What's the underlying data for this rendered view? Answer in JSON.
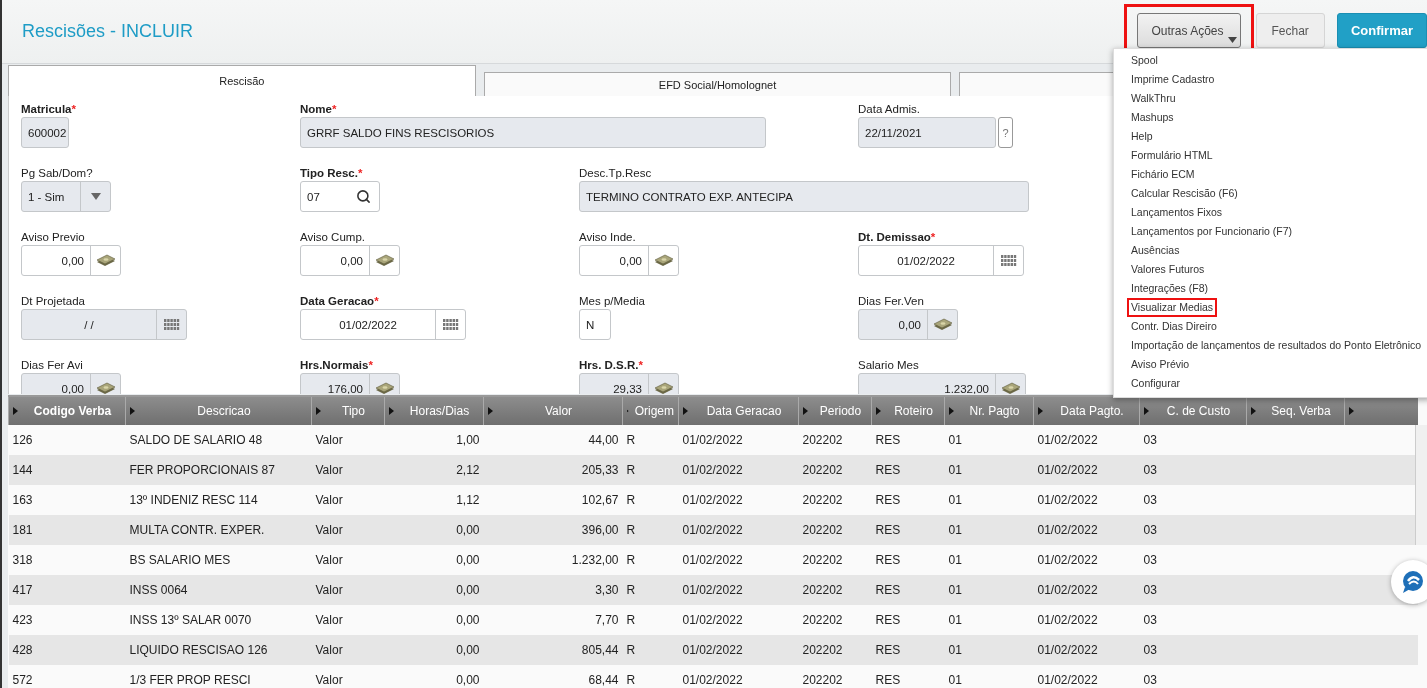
{
  "header": {
    "title": "Rescisões - INCLUIR",
    "buttons": [
      {
        "label": "Outras Ações",
        "kind": "dropdown",
        "highlighted": true
      },
      {
        "label": "Fechar",
        "kind": "secondary",
        "highlighted": false
      },
      {
        "label": "Confirmar",
        "kind": "primary",
        "highlighted": false
      }
    ]
  },
  "tabs": [
    {
      "label": "Rescisão",
      "selected": true
    },
    {
      "label": "EFD Social/Homolognet",
      "selected": false
    },
    {
      "selected": false
    }
  ],
  "form": {
    "rows": [
      [
        {
          "label": "Matricula",
          "required": true,
          "required_mark": "*",
          "value": "600002",
          "kind": "text",
          "readonly": true
        },
        {
          "label": "Nome",
          "required": true,
          "required_mark": "*",
          "value": "GRRF SALDO FINS RESCISORIOS",
          "kind": "text",
          "readonly": true
        },
        null,
        {
          "label": "Data Admis.",
          "required": false,
          "value": "22/11/2021",
          "kind": "help",
          "readonly": true,
          "help": "?"
        }
      ],
      [
        {
          "label": "Pg Sab/Dom?",
          "required": false,
          "value": "1 - Sim",
          "kind": "select",
          "readonly": true
        },
        {
          "label": "Tipo Resc.",
          "required": true,
          "required_mark": "*",
          "value": "07",
          "kind": "search",
          "readonly": false
        },
        {
          "label": "Desc.Tp.Resc",
          "required": false,
          "value": "TERMINO CONTRATO EXP. ANTECIPA",
          "kind": "text",
          "readonly": true
        },
        null
      ],
      [
        {
          "label": "Aviso Previo",
          "required": false,
          "value": "0,00",
          "kind": "money",
          "readonly": false
        },
        {
          "label": "Aviso Cump.",
          "required": false,
          "value": "0,00",
          "kind": "money",
          "readonly": false
        },
        {
          "label": "Aviso Inde.",
          "required": false,
          "value": "0,00",
          "kind": "money",
          "readonly": false
        },
        {
          "label": "Dt. Demissao",
          "required": true,
          "required_mark": "*",
          "value": "01/02/2022",
          "kind": "date",
          "readonly": false
        }
      ],
      [
        {
          "label": "Dt Projetada",
          "required": false,
          "value": "/ /",
          "kind": "date",
          "readonly": true
        },
        {
          "label": "Data Geracao",
          "required": true,
          "required_mark": "*",
          "value": "01/02/2022",
          "kind": "date",
          "readonly": false
        },
        {
          "label": "Mes p/Media",
          "required": false,
          "value": "N",
          "kind": "text",
          "readonly": false
        },
        {
          "label": "Dias Fer.Ven",
          "required": false,
          "value": "0,00",
          "kind": "money",
          "readonly": true
        }
      ],
      [
        {
          "label": "Dias Fer Avi",
          "required": false,
          "value": "0,00",
          "kind": "money",
          "readonly": true
        },
        {
          "label": "Hrs.Normais",
          "required": true,
          "required_mark": "*",
          "value": "176,00",
          "kind": "money",
          "readonly": true
        },
        {
          "label": "Hrs. D.S.R.",
          "required": true,
          "required_mark": "*",
          "value": "29,33",
          "kind": "money",
          "readonly": true
        },
        {
          "label": "Salario Mes",
          "required": false,
          "value": "1.232,00",
          "kind": "money",
          "readonly": true
        }
      ]
    ]
  },
  "table": {
    "columns": [
      "Codigo Verba",
      "Descricao",
      "Tipo",
      "Horas/Dias",
      "Valor",
      "Origem",
      "Data Geracao",
      "Periodo",
      "Roteiro",
      "Nr. Pagto",
      "Data Pagto.",
      "C. de Custo",
      "Seq. Verba",
      null
    ],
    "rows": [
      [
        "126",
        "SALDO DE SALARIO 48",
        "Valor",
        "1,00",
        "44,00",
        "R",
        "01/02/2022",
        "202202",
        "RES",
        "01",
        "01/02/2022",
        "03"
      ],
      [
        "144",
        "FER PROPORCIONAIS 87",
        "Valor",
        "2,12",
        "205,33",
        "R",
        "01/02/2022",
        "202202",
        "RES",
        "01",
        "01/02/2022",
        "03"
      ],
      [
        "163",
        "13º INDENIZ RESC 114",
        "Valor",
        "1,12",
        "102,67",
        "R",
        "01/02/2022",
        "202202",
        "RES",
        "01",
        "01/02/2022",
        "03"
      ],
      [
        "181",
        "MULTA CONTR. EXPER.",
        "Valor",
        "0,00",
        "396,00",
        "R",
        "01/02/2022",
        "202202",
        "RES",
        "01",
        "01/02/2022",
        "03"
      ],
      [
        "318",
        "BS SALARIO MES",
        "Valor",
        "0,00",
        "1.232,00",
        "R",
        "01/02/2022",
        "202202",
        "RES",
        "01",
        "01/02/2022",
        "03"
      ],
      [
        "417",
        "INSS 0064",
        "Valor",
        "0,00",
        "3,30",
        "R",
        "01/02/2022",
        "202202",
        "RES",
        "01",
        "01/02/2022",
        "03"
      ],
      [
        "423",
        "INSS 13º SALAR 0070",
        "Valor",
        "0,00",
        "7,70",
        "R",
        "01/02/2022",
        "202202",
        "RES",
        "01",
        "01/02/2022",
        "03"
      ],
      [
        "428",
        "LIQUIDO RESCISAO 126",
        "Valor",
        "0,00",
        "805,44",
        "R",
        "01/02/2022",
        "202202",
        "RES",
        "01",
        "01/02/2022",
        "03"
      ],
      [
        "572",
        "1/3 FER PROP RESCI",
        "Valor",
        "0,00",
        "68,44",
        "R",
        "01/02/2022",
        "202202",
        "RES",
        "01",
        "01/02/2022",
        "03"
      ]
    ]
  },
  "menu": {
    "items": [
      {
        "label": "Spool",
        "highlighted": false
      },
      {
        "label": "Imprime Cadastro",
        "highlighted": false
      },
      {
        "label": "WalkThru",
        "highlighted": false
      },
      {
        "label": "Mashups",
        "highlighted": false
      },
      {
        "label": "Help",
        "highlighted": false
      },
      {
        "label": "Formulário HTML",
        "highlighted": false
      },
      {
        "label": "Fichário ECM",
        "highlighted": false
      },
      {
        "label": "Calcular Rescisão (F6)",
        "highlighted": false
      },
      {
        "label": "Lançamentos Fixos",
        "highlighted": false
      },
      {
        "label": "Lançamentos por Funcionario (F7)",
        "highlighted": false
      },
      {
        "label": "Ausências",
        "highlighted": false
      },
      {
        "label": "Valores Futuros",
        "highlighted": false
      },
      {
        "label": "Integrações (F8)",
        "highlighted": false
      },
      {
        "label": "Visualizar Medias",
        "highlighted": true
      },
      {
        "label": "Contr. Dias Direiro",
        "highlighted": false
      },
      {
        "label": "Importação de lançamentos de resultados do Ponto Eletrônico",
        "highlighted": false
      },
      {
        "label": "Aviso Prévio",
        "highlighted": false
      },
      {
        "label": "Configurar",
        "highlighted": false
      }
    ]
  }
}
